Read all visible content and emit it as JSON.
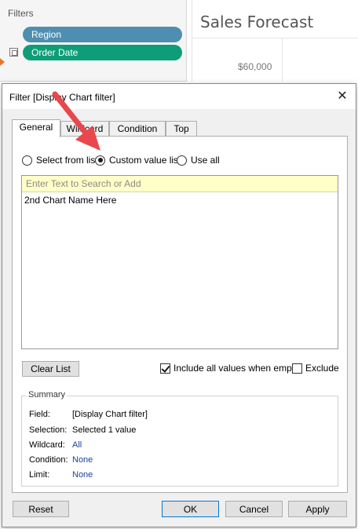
{
  "workspace": {
    "filters_title": "Filters",
    "pills": [
      "Region",
      "Order Date"
    ],
    "chart_title": "Sales Forecast",
    "y_tick": "$60,000"
  },
  "dialog": {
    "title": "Filter [Display Chart filter]",
    "close_glyph": "✕",
    "tabs": [
      {
        "label": "General",
        "active": true
      },
      {
        "label": "Wildcard",
        "active": false
      },
      {
        "label": "Condition",
        "active": false
      },
      {
        "label": "Top",
        "active": false
      }
    ],
    "radios": [
      {
        "label": "Select from list",
        "checked": false
      },
      {
        "label": "Custom value list",
        "checked": true
      },
      {
        "label": "Use all",
        "checked": false
      }
    ],
    "search_placeholder": "Enter Text to Search or Add",
    "list_items": [
      "2nd Chart Name Here"
    ],
    "clear_list_label": "Clear List",
    "include_all_label": "Include all values when empty",
    "include_all_checked": true,
    "exclude_label": "Exclude",
    "exclude_checked": false,
    "summary": {
      "title": "Summary",
      "rows": [
        {
          "key": "Field:",
          "value": "[Display Chart filter]"
        },
        {
          "key": "Selection:",
          "value": "Selected 1 value"
        },
        {
          "key": "Wildcard:",
          "value": "All"
        },
        {
          "key": "Condition:",
          "value": "None"
        },
        {
          "key": "Limit:",
          "value": "None"
        }
      ]
    },
    "buttons": {
      "reset": "Reset",
      "ok": "OK",
      "cancel": "Cancel",
      "apply": "Apply"
    }
  },
  "colors": {
    "region_pill": "#4e8fb0",
    "date_pill": "#0e9e77",
    "search_bg": "#ffffc8",
    "link": "#1f3fa8",
    "annotation_arrow": "#e8474c"
  },
  "icons": {
    "close": "close-icon",
    "calendar": "calendar-icon",
    "annotation": "annotation-arrow-icon"
  }
}
